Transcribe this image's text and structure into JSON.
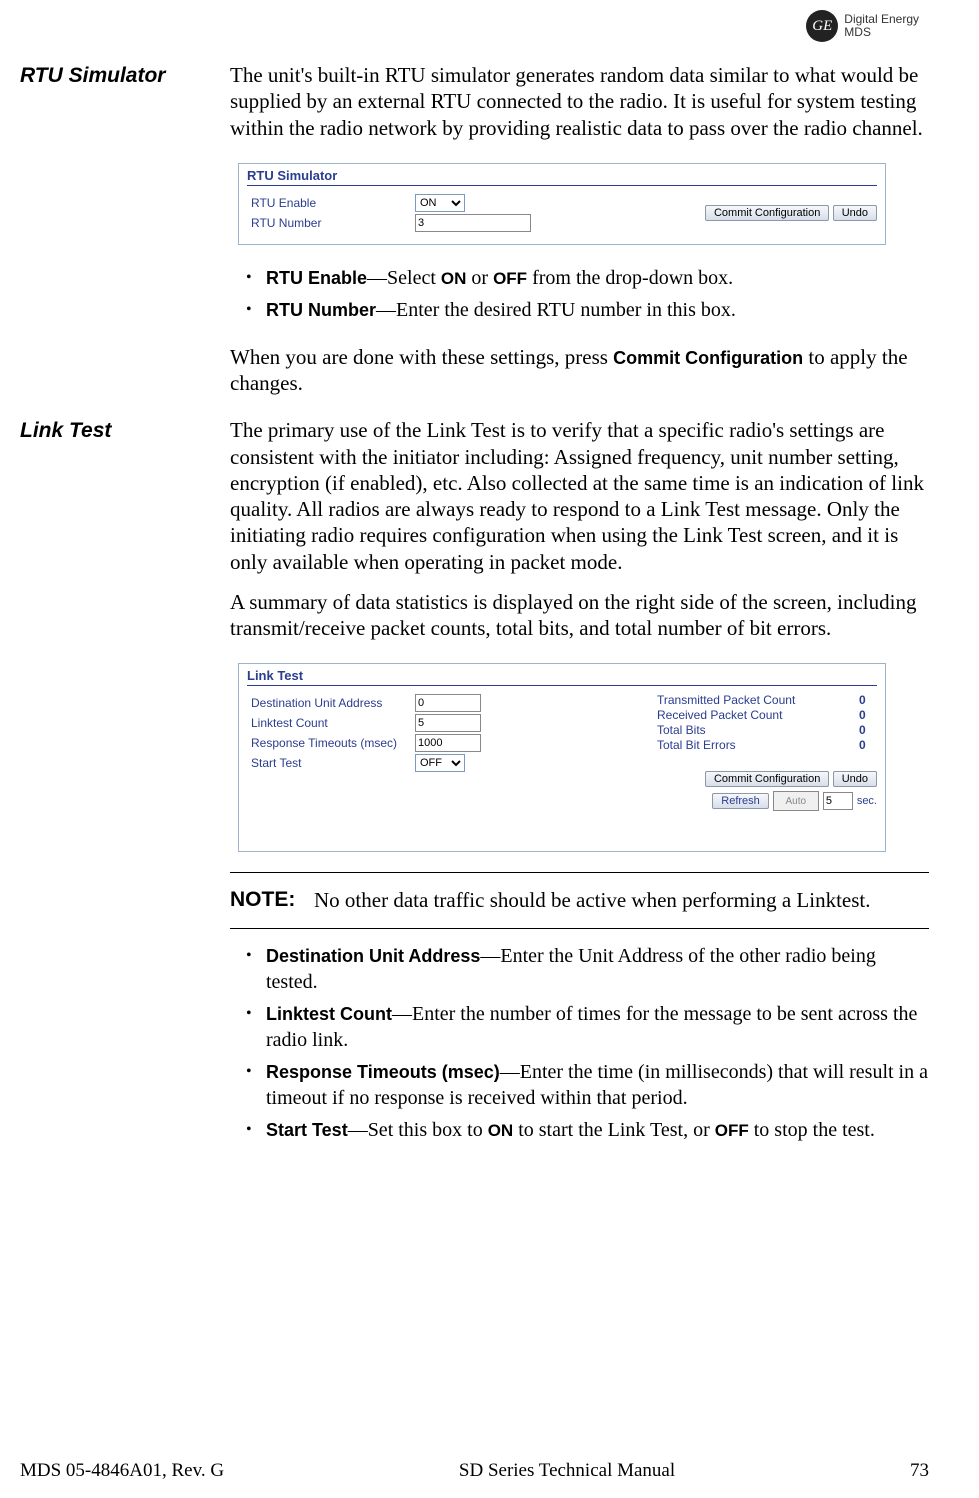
{
  "header": {
    "logo_text": "GE",
    "brand_line1": "Digital Energy",
    "brand_line2": "MDS"
  },
  "rtu": {
    "heading": "RTU Simulator",
    "intro": "The unit's built-in RTU simulator generates random data similar to what would be supplied by an external RTU connected to the radio. It is useful for system testing within the radio network by providing realistic data to pass over the radio channel.",
    "panel_title": "RTU Simulator",
    "enable_label": "RTU Enable",
    "enable_value": "ON",
    "number_label": "RTU Number",
    "number_value": "3",
    "commit_btn": "Commit Configuration",
    "undo_btn": "Undo",
    "b1_label": "RTU Enable",
    "b1_text": "—Select ",
    "b1_on": "ON",
    "b1_or": " or ",
    "b1_off": "OFF",
    "b1_tail": " from the drop-down box.",
    "b2_label": "RTU Number",
    "b2_text": "—Enter the desired RTU number in this box.",
    "done_pre": "When you are done with these settings, press ",
    "done_lbl": "Commit Configuration",
    "done_post": " to apply the changes."
  },
  "link": {
    "heading": "Link Test",
    "para1": "The primary use of the Link Test is to verify that a specific radio's settings are consistent with the initiator including: Assigned frequency, unit number setting, encryption (if enabled), etc. Also collected at the same time is an indication of link quality. All radios are always ready to respond to a Link Test message. Only the initiating radio requires configuration when using the Link Test screen, and it is only available when operating in packet mode.",
    "para2": "A summary of data statistics is displayed on the right side of the screen, including transmit/receive packet counts, total bits, and total number of bit errors.",
    "panel_title": "Link Test",
    "dest_lbl": "Destination Unit Address",
    "dest_val": "0",
    "count_lbl": "Linktest Count",
    "count_val": "5",
    "timeout_lbl": "Response Timeouts (msec)",
    "timeout_val": "1000",
    "start_lbl": "Start Test",
    "start_val": "OFF",
    "stat_tx": "Transmitted Packet Count",
    "stat_rx": "Received Packet Count",
    "stat_bits": "Total Bits",
    "stat_err": "Total Bit Errors",
    "stat_v": "0",
    "commit_btn": "Commit Configuration",
    "undo_btn": "Undo",
    "refresh_btn": "Refresh",
    "auto_lbl": "Auto",
    "sec_val": "5",
    "sec_unit": "sec.",
    "note_lbl": "NOTE:",
    "note_text": "No other data traffic should be active when performing a Linktest.",
    "b1_lbl": "Destination Unit Address",
    "b1_txt": "—Enter the Unit Address of the other radio being tested.",
    "b2_lbl": "Linktest Count",
    "b2_txt": "—Enter the number of times for the message to be sent across the radio link.",
    "b3_lbl": "Response Timeouts (msec)",
    "b3_txt": "—Enter the time (in milliseconds) that will result in a timeout if no response is received within that period.",
    "b4_lbl": "Start Test",
    "b4_pre": "—Set this box to ",
    "b4_on": "ON",
    "b4_mid": " to start the Link Test, or ",
    "b4_off": "OFF",
    "b4_post": " to stop the test."
  },
  "footer": {
    "left": "MDS 05-4846A01, Rev. G",
    "center": "SD Series Technical Manual",
    "right": "73"
  }
}
